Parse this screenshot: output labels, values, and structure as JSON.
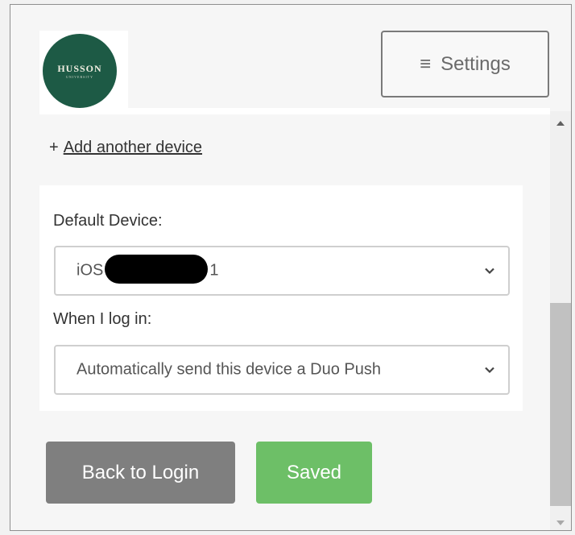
{
  "header": {
    "logo": {
      "wordmark": "HUSSON",
      "subtext": "UNIVERSITY",
      "brand_color": "#1d5a45"
    },
    "settings_button": {
      "icon": "hamburger-menu-icon",
      "label": "Settings"
    }
  },
  "devices": {
    "add_device_prefix": "+",
    "add_device_link": "Add another device"
  },
  "preferences": {
    "default_device_label": "Default Device:",
    "default_device_value_prefix": "iOS",
    "default_device_value_suffix": "1",
    "when_login_label": "When I log in:",
    "when_login_value": "Automatically send this device a Duo Push"
  },
  "actions": {
    "back_label": "Back to Login",
    "saved_label": "Saved",
    "back_color": "#7f7f7f",
    "saved_color": "#6dbf67"
  }
}
